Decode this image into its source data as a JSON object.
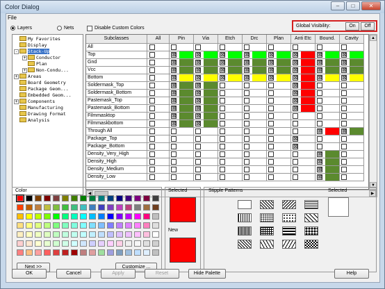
{
  "window": {
    "title": "Color Dialog"
  },
  "menu": {
    "file": "File"
  },
  "toolbar": {
    "layers": "Layers",
    "nets": "Nets",
    "disable_custom": "Disable Custom Colors",
    "global_visibility": "Global Visibility:",
    "on": "On",
    "off": "Off"
  },
  "tree": {
    "items": [
      {
        "label": "My Favorites",
        "level": 1,
        "expander": ""
      },
      {
        "label": "Display",
        "level": 1,
        "expander": ""
      },
      {
        "label": "Stack-Up",
        "level": 1,
        "expander": "-",
        "selected": true
      },
      {
        "label": "Conductor",
        "level": 2,
        "expander": "+"
      },
      {
        "label": "Plan",
        "level": 2,
        "expander": ""
      },
      {
        "label": "Non-Condu...",
        "level": 2,
        "expander": "+"
      },
      {
        "label": "Areas",
        "level": 1,
        "expander": "+"
      },
      {
        "label": "Board Geometry",
        "level": 1,
        "expander": ""
      },
      {
        "label": "Package Geom...",
        "level": 1,
        "expander": ""
      },
      {
        "label": "Embedded Geom...",
        "level": 1,
        "expander": ""
      },
      {
        "label": "Components",
        "level": 1,
        "expander": "+"
      },
      {
        "label": "Manufacturing",
        "level": 1,
        "expander": ""
      },
      {
        "label": "Drawing Format",
        "level": 1,
        "expander": ""
      },
      {
        "label": "Analysis",
        "level": 1,
        "expander": ""
      }
    ]
  },
  "grid": {
    "headers": [
      "Subclasses",
      "All",
      "Pin",
      "Via",
      "Etch",
      "Drc",
      "Plan",
      "Anti Etc",
      "Bound.",
      "Cavity"
    ],
    "colors": {
      "G": "#00ff00",
      "Y": "#ffff00",
      "D": "#5b8a2e",
      "R": "#ff0000"
    },
    "rows": [
      {
        "name": "All",
        "cells": "bg.........",
        "note": ""
      },
      {
        "name": "Top",
        "cells": "b.GGGGGRGGG"
      },
      {
        "name": "Gnd",
        "cells": "b.DDDDDRDDD"
      },
      {
        "name": "Vcc",
        "cells": "b.DDDDDRDDD"
      },
      {
        "name": "Bottom",
        "cells": "b.YYYYYRYYY"
      },
      {
        "name": "Soldermask_Top",
        "cells": "b.DD...R..."
      },
      {
        "name": "Soldermask_Bottom",
        "cells": "b.DD...R..."
      },
      {
        "name": "Pastemask_Top",
        "cells": "b.DD...R..."
      },
      {
        "name": "Pastemask_Bottom",
        "cells": "b.DD...R..."
      },
      {
        "name": "Filmmasktop",
        "cells": "b.DD......."
      },
      {
        "name": "Filmmaskbottom",
        "cells": "b.DD......."
      },
      {
        "name": "Through All",
        "cells": "b......bRDDD"
      },
      {
        "name": "Package_Top",
        "cells": "b......X..."
      },
      {
        "name": "Package_Bottom",
        "cells": "b......X..."
      },
      {
        "name": "Density_Very_High",
        "cells": "b.......D.."
      },
      {
        "name": "Density_High",
        "cells": "b.......D.."
      },
      {
        "name": "Density_Medium",
        "cells": "b.......D.."
      },
      {
        "name": "Density_Low",
        "cells": "b.......D.."
      }
    ]
  },
  "color": {
    "label": "Color",
    "next": "Next >>",
    "customize": "Customize ..."
  },
  "selected": {
    "label": "Selected",
    "color": "#ff0000",
    "new_label": "New",
    "new_color": "#ff0000"
  },
  "stipple": {
    "label": "Stipple Patterns",
    "selected_label": "Selected"
  },
  "buttons": {
    "ok": "OK",
    "cancel": "Cancel",
    "apply": "Apply",
    "reset": "Reset",
    "hide": "Hide Palette",
    "help": "Help"
  }
}
